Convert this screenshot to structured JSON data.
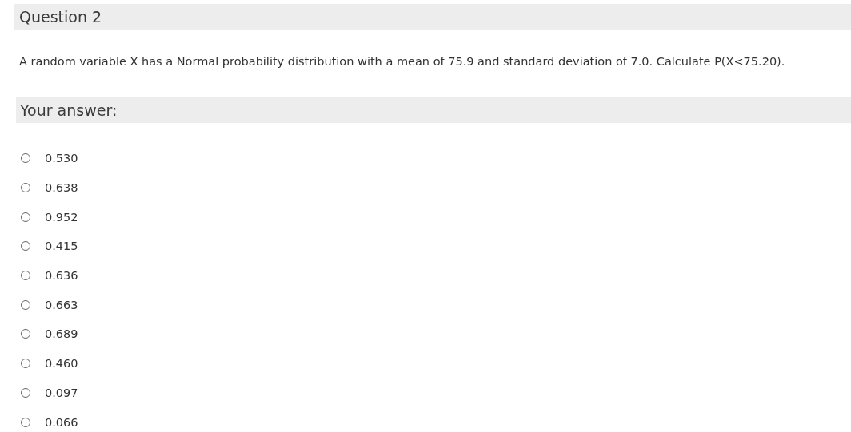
{
  "question": {
    "title": "Question 2",
    "text": "A random variable X has a Normal probability distribution with a mean of 75.9 and standard deviation of 7.0. Calculate P(X<75.20)."
  },
  "answer": {
    "heading": "Your answer:",
    "options": [
      {
        "label": "0.530",
        "selected": false
      },
      {
        "label": "0.638",
        "selected": false
      },
      {
        "label": "0.952",
        "selected": false
      },
      {
        "label": "0.415",
        "selected": false
      },
      {
        "label": "0.636",
        "selected": false
      },
      {
        "label": "0.663",
        "selected": false
      },
      {
        "label": "0.689",
        "selected": false
      },
      {
        "label": "0.460",
        "selected": false
      },
      {
        "label": "0.097",
        "selected": false
      },
      {
        "label": "0.066",
        "selected": false
      }
    ]
  }
}
